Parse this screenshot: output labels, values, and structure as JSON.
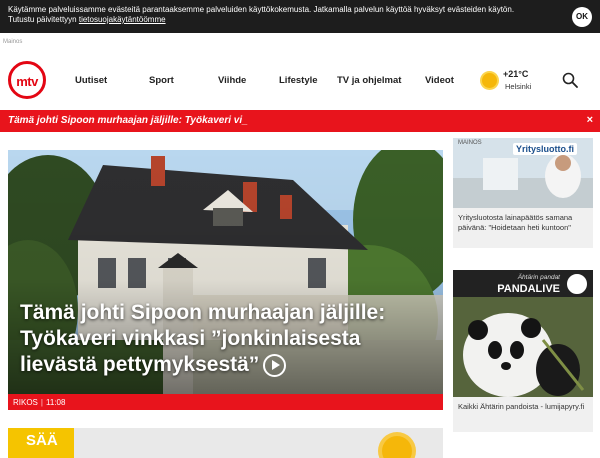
{
  "cookie": {
    "text": "Käytämme palveluissamme evästeitä parantaaksemme palveluiden käyttökokemusta. Jatkamalla palvelun käyttöä hyväksyt evästeiden käytön.",
    "text2": "Tutustu päivitettyyn ",
    "link": "tietosuojakäytäntöömme",
    "ok": "OK"
  },
  "ad_label": "Mainos",
  "header": {
    "logo": "mtv",
    "nav": [
      "Uutiset",
      "Sport",
      "Viihde",
      "Lifestyle",
      "TV ja ohjelmat",
      "Videot"
    ],
    "weather": {
      "temp": "+21°C",
      "city": "Helsinki"
    }
  },
  "breaking": {
    "text": "Tämä johti Sipoon murhaajan jäljille: Työkaveri vi_",
    "close": "×"
  },
  "hero": {
    "headline": "Tämä johti Sipoon murhaajan jäljille: Työkaveri vinkkasi ”jonkinlaisesta lievästä pettymyksestä”",
    "category": "RIKOS",
    "time": "11:08"
  },
  "weather_tile": {
    "label": "SÄÄ"
  },
  "sidebar": {
    "ad1": {
      "mainos": "MAINOS",
      "brand": "Yritysluotto.fi",
      "caption": "Yritysluotosta lainapäätös samana päivänä: \"Hoidetaan heti kuntoon\""
    },
    "ad2": {
      "kicker": "Ähtärin pandat",
      "title": "PANDALIVE",
      "caption": "Kaikki Ähtärin pandoista - lumijapyry.fi"
    }
  },
  "colors": {
    "brand_red": "#e8141c",
    "weather_yellow": "#f5c400"
  }
}
